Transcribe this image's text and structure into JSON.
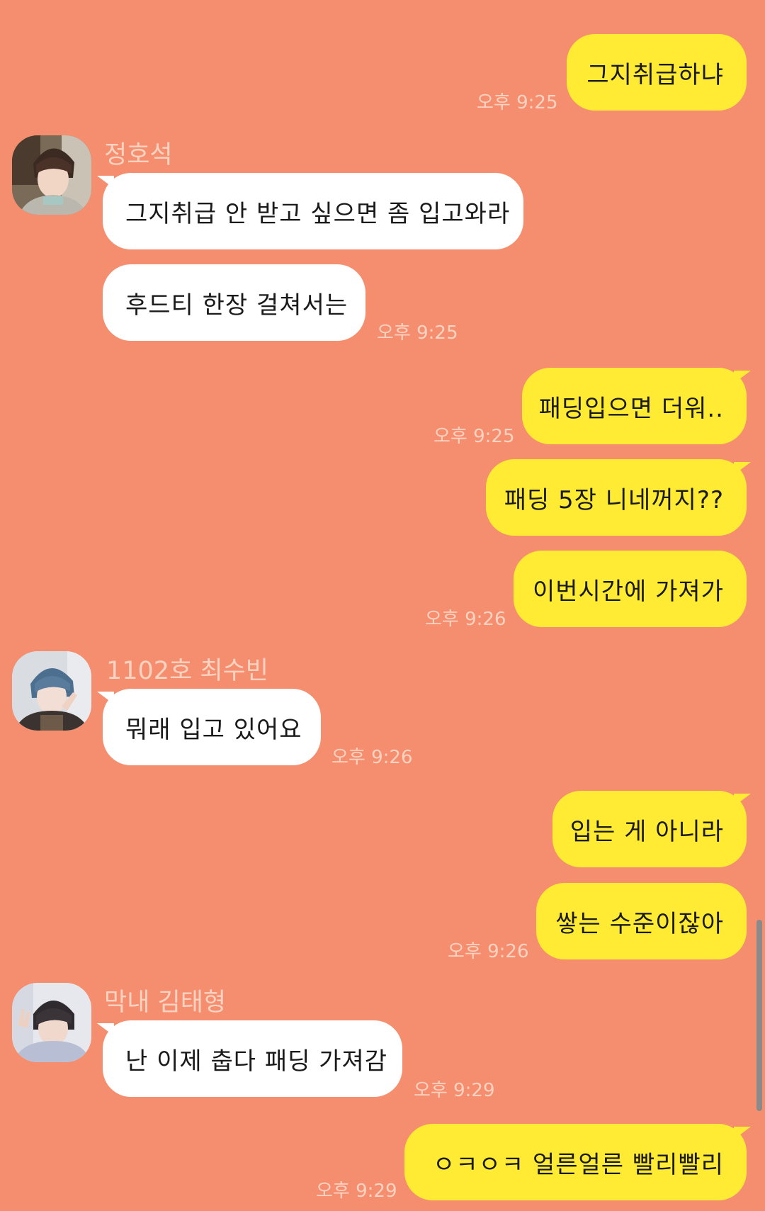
{
  "chat": {
    "messages": [
      {
        "text": "그지취급하냐"
      },
      {
        "sender": "정호석",
        "text": "그지취급 안 받고 싶으면 좀 입고와라"
      },
      {
        "text": "후드티 한장 걸쳐서는"
      },
      {
        "text": "패딩입으면 더워.."
      },
      {
        "text": "패딩 5장 니네꺼지??"
      },
      {
        "text": "이번시간에 가져가"
      },
      {
        "sender": "1102호 최수빈",
        "text": "뭐래 입고 있어요"
      },
      {
        "text": "입는 게 아니라"
      },
      {
        "text": "쌓는 수준이잖아"
      },
      {
        "sender": "막내 김태형",
        "text": "난 이제 춥다 패딩 가져감"
      },
      {
        "text": "ㅇㅋㅇㅋ 얼른얼른 빨리빨리"
      }
    ],
    "times": [
      "오후 9:25",
      "오후 9:25",
      "오후 9:25",
      "오후 9:26",
      "오후 9:26",
      "오후 9:26",
      "오후 9:29",
      "오후 9:29"
    ]
  },
  "colors": {
    "background": "#F58E6E",
    "my_bubble": "#FFEB33",
    "other_bubble": "#FFFFFF",
    "time_text": "#FFD3C2"
  }
}
